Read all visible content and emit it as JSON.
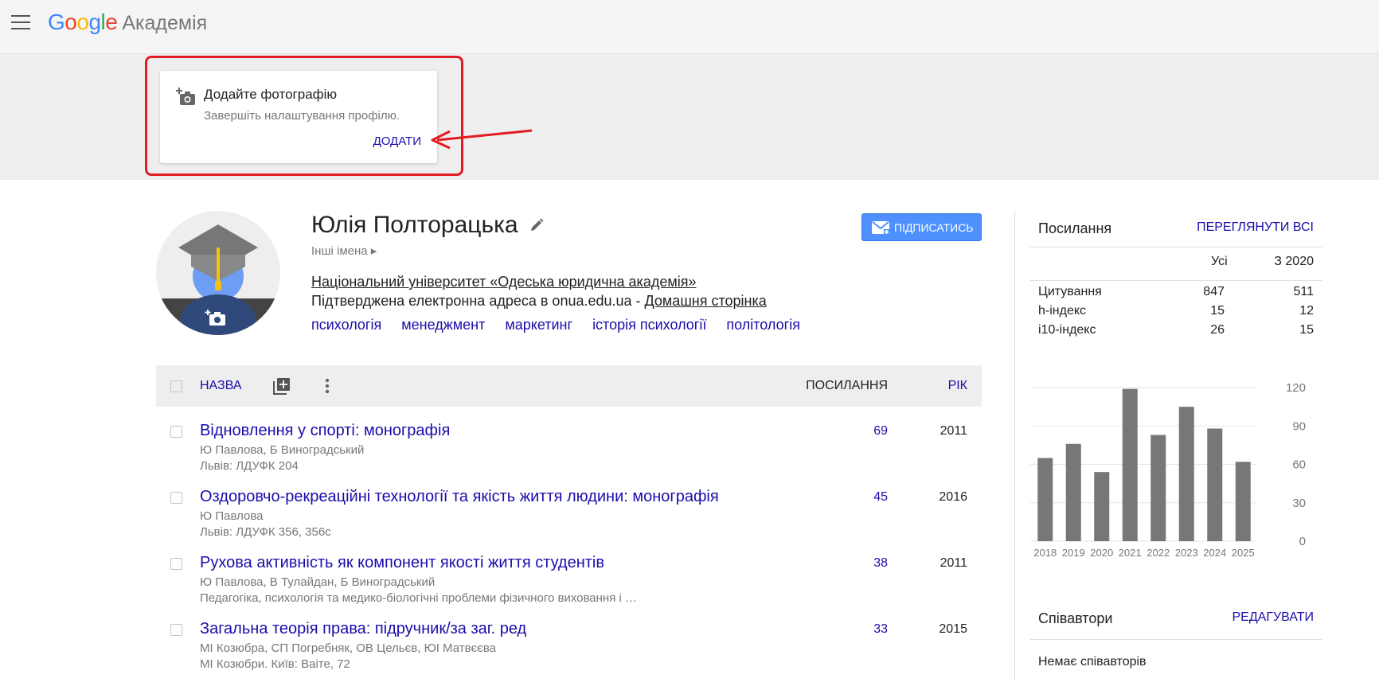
{
  "header": {
    "logo": {
      "g1": "G",
      "g2": "o",
      "g3": "o",
      "g4": "g",
      "g5": "l",
      "g6": "e"
    },
    "product": "Академія"
  },
  "photo_prompt": {
    "title": "Додайте фотографію",
    "subtitle": "Завершіть налаштування профілю.",
    "action": "ДОДАТИ"
  },
  "profile": {
    "name": "Юлія Полторацька",
    "other_names": "Інші імена ▸",
    "affiliation": "Національний університет «Одеська юридична академія»",
    "email_text": "Підтверджена електронна адреса в onua.edu.ua - ",
    "homepage": "Домашня сторінка",
    "interests": [
      "психологія",
      "менеджмент",
      "маркетинг",
      "історія психології",
      "політологія"
    ],
    "follow_label": "ПІДПИСАТИСЬ"
  },
  "table": {
    "col_title": "НАЗВА",
    "col_citations": "ПОСИЛАННЯ",
    "col_year": "РІК",
    "rows": [
      {
        "title": "Відновлення у спорті: монографія",
        "authors": "Ю Павлова, Б Виноградський",
        "venue": "Львів: ЛДУФК 204",
        "citations": "69",
        "year": "2011"
      },
      {
        "title": "Оздоровчо-рекреаційні технології та якість життя людини: монографія",
        "authors": "Ю Павлова",
        "venue": "Львів: ЛДУФК 356, 356с",
        "citations": "45",
        "year": "2016"
      },
      {
        "title": "Рухова активність як компонент якості життя студентів",
        "authors": "Ю Павлова, В Тулайдан, Б Виноградський",
        "venue": "Педагогіка, психологія та медико-біологічні проблеми фізичного виховання і …",
        "citations": "38",
        "year": "2011"
      },
      {
        "title": "Загальна теорія права: підручник/за заг. ред",
        "authors": "МІ Козюбра, СП Погребняк, ОВ Цельєв, ЮІ Матвєєва",
        "venue": "МІ Козюбри. Київ: Ваіте, 72",
        "citations": "33",
        "year": "2015"
      }
    ]
  },
  "sidebar": {
    "cited_by": {
      "title": "Посилання",
      "view_all": "ПЕРЕГЛЯНУТИ ВСІ",
      "col_all": "Усі",
      "col_since": "З 2020",
      "rows": [
        {
          "label": "Цитування",
          "all": "847",
          "since": "511"
        },
        {
          "label": "h-індекс",
          "all": "15",
          "since": "12"
        },
        {
          "label": "i10-індекс",
          "all": "26",
          "since": "15"
        }
      ]
    },
    "coauthors": {
      "title": "Співавтори",
      "edit": "РЕДАГУВАТИ",
      "empty": "Немає співавторів"
    }
  },
  "colors": {
    "link": "#1a0dab",
    "bar": "#777777",
    "follow": "#4d90fe",
    "annotation": "#e31b23"
  },
  "chart_data": {
    "type": "bar",
    "categories": [
      "2018",
      "2019",
      "2020",
      "2021",
      "2022",
      "2023",
      "2024",
      "2025"
    ],
    "values": [
      65,
      76,
      54,
      119,
      83,
      105,
      88,
      62
    ],
    "ylim": [
      0,
      120
    ],
    "yticks": [
      "120",
      "90",
      "60",
      "30",
      "0"
    ],
    "ytick_values": [
      120,
      90,
      60,
      30,
      0
    ],
    "grid": true
  }
}
